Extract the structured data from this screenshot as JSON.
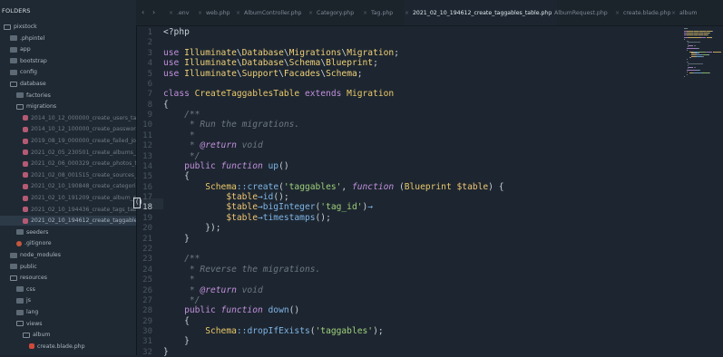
{
  "sidebar": {
    "title": "FOLDERS",
    "items": [
      {
        "label": "pixstock",
        "kind": "folder-open",
        "depth": 0
      },
      {
        "label": ".phpintel",
        "kind": "folder-closed",
        "depth": 1
      },
      {
        "label": "app",
        "kind": "folder-closed",
        "depth": 1
      },
      {
        "label": "bootstrap",
        "kind": "folder-closed",
        "depth": 1
      },
      {
        "label": "config",
        "kind": "folder-closed",
        "depth": 1
      },
      {
        "label": "database",
        "kind": "folder-open",
        "depth": 1
      },
      {
        "label": "factories",
        "kind": "folder-closed",
        "depth": 2
      },
      {
        "label": "migrations",
        "kind": "folder-open",
        "depth": 2
      },
      {
        "label": "2014_10_12_000000_create_users_table",
        "kind": "file",
        "depth": 3
      },
      {
        "label": "2014_10_12_100000_create_password_r",
        "kind": "file",
        "depth": 3
      },
      {
        "label": "2019_08_19_000000_create_failed_jobs",
        "kind": "file",
        "depth": 3
      },
      {
        "label": "2021_02_05_230501_create_albums_tal",
        "kind": "file",
        "depth": 3
      },
      {
        "label": "2021_02_06_000329_create_photos_tal",
        "kind": "file",
        "depth": 3
      },
      {
        "label": "2021_02_08_001515_create_sources_tal",
        "kind": "file",
        "depth": 3
      },
      {
        "label": "2021_02_10_190848_create_categories_",
        "kind": "file",
        "depth": 3
      },
      {
        "label": "2021_02_10_191209_create_album_categ",
        "kind": "file",
        "depth": 3
      },
      {
        "label": "2021_02_10_194436_create_tags_table.",
        "kind": "file",
        "depth": 3
      },
      {
        "label": "2021_02_10_194612_create_taggables_t",
        "kind": "file",
        "depth": 3,
        "selected": true
      },
      {
        "label": "seeders",
        "kind": "folder-closed",
        "depth": 2
      },
      {
        "label": ".gitignore",
        "kind": "git",
        "depth": 2
      },
      {
        "label": "node_modules",
        "kind": "folder-closed",
        "depth": 1
      },
      {
        "label": "public",
        "kind": "folder-closed",
        "depth": 1
      },
      {
        "label": "resources",
        "kind": "folder-open",
        "depth": 1
      },
      {
        "label": "css",
        "kind": "folder-closed",
        "depth": 2
      },
      {
        "label": "js",
        "kind": "folder-closed",
        "depth": 2
      },
      {
        "label": "lang",
        "kind": "folder-closed",
        "depth": 2
      },
      {
        "label": "views",
        "kind": "folder-open",
        "depth": 2
      },
      {
        "label": "album",
        "kind": "folder-open",
        "depth": 3
      },
      {
        "label": "create.blade.php",
        "kind": "blade",
        "depth": 4
      }
    ]
  },
  "tabs": {
    "nav_left": "‹",
    "nav_right": "›",
    "items": [
      {
        "label": ".env",
        "active": false
      },
      {
        "label": "web.php",
        "active": false
      },
      {
        "label": "AlbumController.php",
        "active": false
      },
      {
        "label": "Category.php",
        "active": false
      },
      {
        "label": "Tag.php",
        "active": false
      },
      {
        "label": "2021_02_10_194612_create_taggables_table.php",
        "active": true
      },
      {
        "label": "AlbumRequest.php",
        "active": false
      },
      {
        "label": "create.blade.php",
        "active": false
      },
      {
        "label": "album",
        "active": false
      }
    ]
  },
  "editor": {
    "current_line": 18,
    "cursor_hint": "()",
    "line_numbers": [
      "1",
      "2",
      "3",
      "4",
      "5",
      "6",
      "7",
      "8",
      "9",
      "10",
      "11",
      "12",
      "13",
      "14",
      "15",
      "16",
      "17",
      "18",
      "19",
      "20",
      "21",
      "22",
      "23",
      "24",
      "25",
      "26",
      "27",
      "28",
      "29",
      "30",
      "31",
      "32"
    ],
    "lines": [
      [
        [
          "plain",
          "<?php"
        ]
      ],
      [],
      [
        [
          "kw",
          "use "
        ],
        [
          "ns",
          "Illuminate"
        ],
        [
          "plain",
          "\\"
        ],
        [
          "ns",
          "Database"
        ],
        [
          "plain",
          "\\"
        ],
        [
          "ns",
          "Migrations"
        ],
        [
          "plain",
          "\\"
        ],
        [
          "ns",
          "Migration"
        ],
        [
          "plain",
          ";"
        ]
      ],
      [
        [
          "kw",
          "use "
        ],
        [
          "ns",
          "Illuminate"
        ],
        [
          "plain",
          "\\"
        ],
        [
          "ns",
          "Database"
        ],
        [
          "plain",
          "\\"
        ],
        [
          "ns",
          "Schema"
        ],
        [
          "plain",
          "\\"
        ],
        [
          "ns",
          "Blueprint"
        ],
        [
          "plain",
          ";"
        ]
      ],
      [
        [
          "kw",
          "use "
        ],
        [
          "ns",
          "Illuminate"
        ],
        [
          "plain",
          "\\"
        ],
        [
          "ns",
          "Support"
        ],
        [
          "plain",
          "\\"
        ],
        [
          "ns",
          "Facades"
        ],
        [
          "plain",
          "\\"
        ],
        [
          "ns",
          "Schema"
        ],
        [
          "plain",
          ";"
        ]
      ],
      [],
      [
        [
          "kw",
          "class "
        ],
        [
          "cls",
          "CreateTaggablesTable "
        ],
        [
          "kw",
          "extends "
        ],
        [
          "cls",
          "Migration"
        ]
      ],
      [
        [
          "plain",
          "{"
        ]
      ],
      [
        [
          "cm",
          "    /**"
        ]
      ],
      [
        [
          "cm",
          "     * Run the migrations."
        ]
      ],
      [
        [
          "cm",
          "     *"
        ]
      ],
      [
        [
          "cm",
          "     * "
        ],
        [
          "kwi",
          "@return"
        ],
        [
          "cm",
          " void"
        ]
      ],
      [
        [
          "cm",
          "     */"
        ]
      ],
      [
        [
          "kw",
          "    public "
        ],
        [
          "kwi",
          "function "
        ],
        [
          "fn",
          "up"
        ],
        [
          "plain",
          "()"
        ]
      ],
      [
        [
          "plain",
          "    {"
        ]
      ],
      [
        [
          "plain",
          "        "
        ],
        [
          "cls",
          "Schema"
        ],
        [
          "op",
          "::"
        ],
        [
          "fn",
          "create"
        ],
        [
          "plain",
          "("
        ],
        [
          "str",
          "'taggables'"
        ],
        [
          "plain",
          ", "
        ],
        [
          "kwi",
          "function "
        ],
        [
          "plain",
          "("
        ],
        [
          "cls",
          "Blueprint "
        ],
        [
          "var",
          "$table"
        ],
        [
          "plain",
          ") {"
        ]
      ],
      [
        [
          "plain",
          "            "
        ],
        [
          "var",
          "$table"
        ],
        [
          "op",
          "→"
        ],
        [
          "fn",
          "id"
        ],
        [
          "plain",
          "();"
        ]
      ],
      [
        [
          "plain",
          "            "
        ],
        [
          "var",
          "$table"
        ],
        [
          "op",
          "→"
        ],
        [
          "fn",
          "bigInteger"
        ],
        [
          "plain",
          "("
        ],
        [
          "str",
          "'tag_id'"
        ],
        [
          "plain",
          ")"
        ],
        [
          "op",
          "→"
        ]
      ],
      [
        [
          "plain",
          "            "
        ],
        [
          "var",
          "$table"
        ],
        [
          "op",
          "→"
        ],
        [
          "fn",
          "timestamps"
        ],
        [
          "plain",
          "();"
        ]
      ],
      [
        [
          "plain",
          "        });"
        ]
      ],
      [
        [
          "plain",
          "    }"
        ]
      ],
      [],
      [
        [
          "cm",
          "    /**"
        ]
      ],
      [
        [
          "cm",
          "     * Reverse the migrations."
        ]
      ],
      [
        [
          "cm",
          "     *"
        ]
      ],
      [
        [
          "cm",
          "     * "
        ],
        [
          "kwi",
          "@return"
        ],
        [
          "cm",
          " void"
        ]
      ],
      [
        [
          "cm",
          "     */"
        ]
      ],
      [
        [
          "kw",
          "    public "
        ],
        [
          "kwi",
          "function "
        ],
        [
          "fn",
          "down"
        ],
        [
          "plain",
          "()"
        ]
      ],
      [
        [
          "plain",
          "    {"
        ]
      ],
      [
        [
          "plain",
          "        "
        ],
        [
          "cls",
          "Schema"
        ],
        [
          "op",
          "::"
        ],
        [
          "fn",
          "dropIfExists"
        ],
        [
          "plain",
          "("
        ],
        [
          "str",
          "'taggables'"
        ],
        [
          "plain",
          ");"
        ]
      ],
      [
        [
          "plain",
          "    }"
        ]
      ],
      [
        [
          "plain",
          "}"
        ]
      ]
    ]
  },
  "colors": {
    "background": "#1d2630",
    "keyword": "#c28fdd",
    "class": "#ebc86a",
    "function": "#7fb4e6",
    "string": "#9fd07a",
    "comment": "#6c7884"
  }
}
